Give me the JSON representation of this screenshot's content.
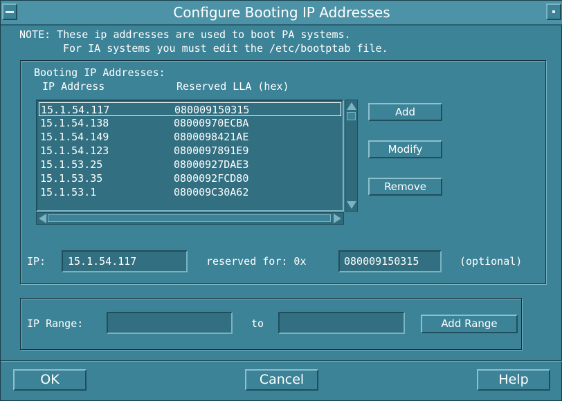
{
  "window": {
    "title": "Configure Booting IP Addresses"
  },
  "note": {
    "line1": "NOTE: These ip addresses are used to boot PA systems.",
    "line2": "For IA systems you must edit the /etc/bootptab file."
  },
  "booting": {
    "label": "Booting IP Addresses:",
    "col_ip": "IP Address",
    "col_lla": "Reserved LLA (hex)",
    "rows": [
      {
        "ip": "15.1.54.117",
        "lla": "080009150315"
      },
      {
        "ip": "15.1.54.138",
        "lla": "08000970ECBA"
      },
      {
        "ip": "15.1.54.149",
        "lla": "0800098421AE"
      },
      {
        "ip": "15.1.54.123",
        "lla": "0800097891E9"
      },
      {
        "ip": "15.1.53.25",
        "lla": "08000927DAE3"
      },
      {
        "ip": "15.1.53.35",
        "lla": "0800092FCD80"
      },
      {
        "ip": "15.1.53.1",
        "lla": "080009C30A62"
      }
    ],
    "selected_index": 0,
    "buttons": {
      "add": "Add",
      "modify": "Modify",
      "remove": "Remove"
    }
  },
  "entry": {
    "ip_label": "IP:",
    "ip_value": "15.1.54.117",
    "reserved_label": "reserved for: 0x",
    "lla_value": "080009150315",
    "optional_label": "(optional)"
  },
  "range": {
    "label": "IP Range:",
    "to_label": "to",
    "from_value": "",
    "to_value": "",
    "button": "Add Range"
  },
  "footer": {
    "ok": "OK",
    "cancel": "Cancel",
    "help": "Help"
  },
  "icons": {
    "window_menu": "window-menu-icon",
    "maximize": "maximize-icon"
  }
}
